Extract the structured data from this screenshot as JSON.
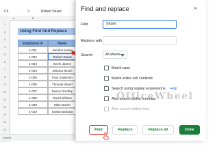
{
  "sheet": {
    "name_box": "C6",
    "fx": "fx",
    "formula_value": "Robert Stuart",
    "columns": [
      "A",
      "B",
      "C"
    ],
    "rows": [
      "1",
      "2",
      "3",
      "4",
      "5",
      "6",
      "7",
      "8",
      "9",
      "10",
      "11",
      "12",
      "13",
      "14",
      "15",
      "16"
    ],
    "banner": "Using Find And Replace",
    "headers": [
      "Employee Id",
      "Name"
    ],
    "data": [
      [
        "1-001",
        "Jennifer Helan"
      ],
      [
        "1-002",
        "Robert Stuart"
      ],
      [
        "1-003",
        "Kevin James"
      ],
      [
        "1-004",
        "Jessica Nicole"
      ],
      [
        "1-005",
        "Paul Anderson"
      ],
      [
        "1-006",
        "Thomas Stuart"
      ],
      [
        "1-007",
        "Nancy Dorothy"
      ],
      [
        "1-008",
        "David William"
      ],
      [
        "1-009",
        "Mike Daniel"
      ],
      [
        "1-010",
        "Susan Barbara"
      ]
    ],
    "sheet_tab": "Sheet1"
  },
  "dialog": {
    "title": "Find and replace",
    "close": "×",
    "find_label": "Find",
    "find_value": "Stuart",
    "replace_label": "Replace with",
    "replace_value": "",
    "search_label": "Search",
    "search_value": "All sheets",
    "options": [
      {
        "label": "Match case",
        "disabled": false
      },
      {
        "label": "Match entire cell contents",
        "disabled": false
      },
      {
        "label": "Search using regular expressions",
        "disabled": false,
        "help": "Help"
      },
      {
        "label": "Also search within formulas",
        "disabled": false
      },
      {
        "label": "Also search within links",
        "disabled": true
      }
    ],
    "buttons": {
      "find": "Find",
      "replace": "Replace",
      "replace_all": "Replace all",
      "done": "Done"
    }
  },
  "watermark": "OfficeWheel",
  "colors": {
    "accent": "#1a73e8",
    "done_green": "#188038",
    "highlight_red": "#d93025",
    "header_blue": "#8eb4e3",
    "banner_blue": "#a9c5e8"
  }
}
